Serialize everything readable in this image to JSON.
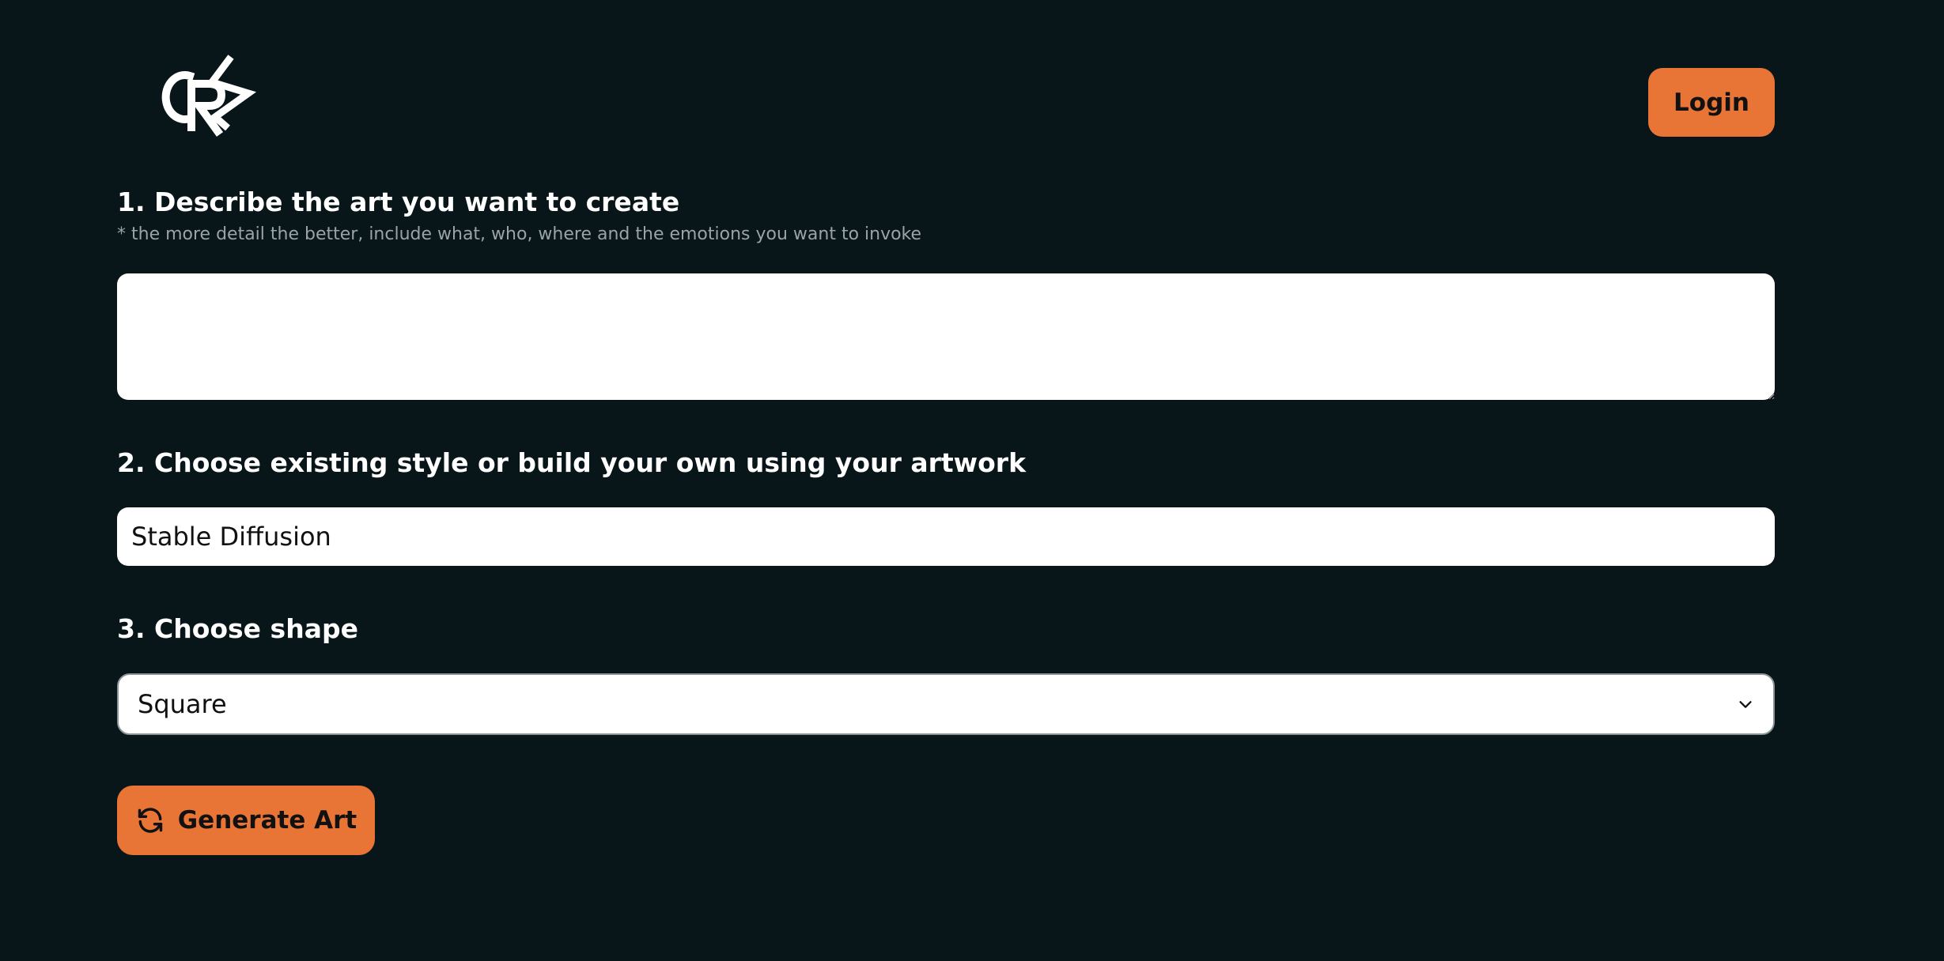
{
  "header": {
    "logo_text": "CRS",
    "login_label": "Login"
  },
  "step1": {
    "title": "1. Describe the art you want to create",
    "hint": "* the more detail the better, include what, who, where and the emotions you want to invoke",
    "value": "",
    "placeholder": ""
  },
  "step2": {
    "title": "2. Choose existing style or build your own using your artwork",
    "value": "Stable Diffusion"
  },
  "step3": {
    "title": "3. Choose shape",
    "selected": "Square",
    "icon": "chevron-down-icon"
  },
  "generate": {
    "label": "Generate Art",
    "icon": "refresh-icon"
  },
  "colors": {
    "background": "#081519",
    "accent": "#e87535",
    "text": "#ffffff",
    "hint": "#9aa3a6"
  }
}
